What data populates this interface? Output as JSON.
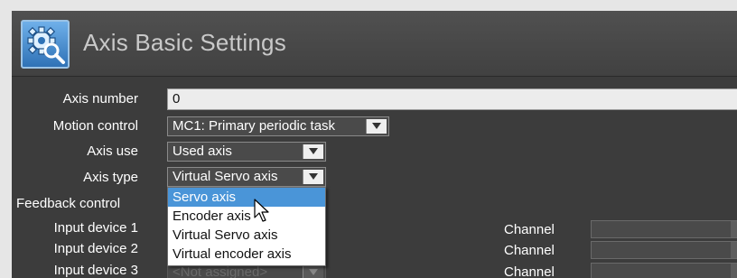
{
  "header": {
    "title": "Axis Basic Settings",
    "icon": "gear-magnifier-icon"
  },
  "fields": {
    "axis_number": {
      "label": "Axis number",
      "value": "0"
    },
    "motion_control": {
      "label": "Motion control",
      "value": "MC1: Primary periodic task"
    },
    "axis_use": {
      "label": "Axis use",
      "value": "Used axis"
    },
    "axis_type": {
      "label": "Axis type",
      "value": "Virtual Servo axis"
    },
    "feedback_control": {
      "label": "Feedback control"
    },
    "input_device_1": {
      "label": "Input device 1",
      "channel_label": "Channel"
    },
    "input_device_2": {
      "label": "Input device 2",
      "channel_label": "Channel"
    },
    "input_device_3": {
      "label": "Input device 3",
      "value": "<Not assigned>",
      "channel_label": "Channel"
    }
  },
  "axis_type_options": [
    "Servo axis",
    "Encoder axis",
    "Virtual Servo axis",
    "Virtual encoder axis"
  ],
  "highlighted_option": "Servo axis",
  "colors": {
    "panel_bg": "#3c3c3c",
    "highlight": "#4a95d8",
    "icon_blue": "#2f72b6"
  }
}
